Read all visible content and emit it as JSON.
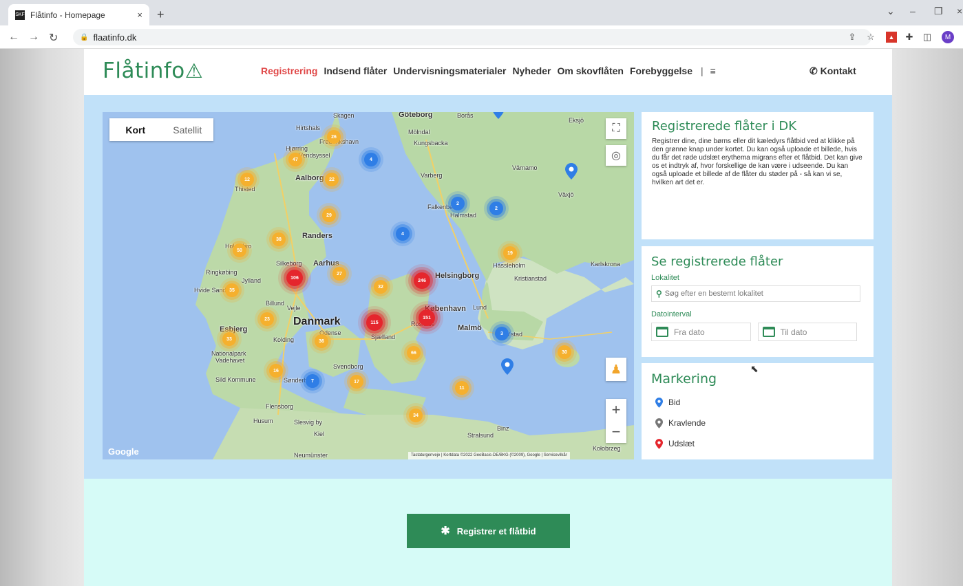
{
  "browser": {
    "tab_title": "Flåtinfo - Homepage",
    "favicon_text": "SKF",
    "url": "flaatinfo.dk",
    "avatar_letter": "M"
  },
  "header": {
    "logo": "Flåtinfo",
    "nav": [
      "Registrering",
      "Indsend flåter",
      "Undervisningsmaterialer",
      "Nyheder",
      "Om skovflåten",
      "Forebyggelse"
    ],
    "contact": "Kontakt"
  },
  "map": {
    "toggle_map": "Kort",
    "toggle_satellite": "Satellit",
    "google": "Google",
    "attribution": "Tastaturgenveje | Kortdata ©2022 GeoBasis-DE/BKG (©2009), Google | Servicevilkår",
    "labels": {
      "skagen": "Skagen",
      "goteborg": "Göteborg",
      "boras": "Borås",
      "eksjo": "Eksjö",
      "hirtshals": "Hirtshals",
      "frederikshavn": "Frederikshavn",
      "molndal": "Mölndal",
      "kungsbacka": "Kungsbacka",
      "hjorring": "Hjørring",
      "vendsyssel": "Vendsyssel",
      "varnamo": "Värnamo",
      "aalborg": "Aalborg",
      "varberg": "Varberg",
      "thisted": "Thisted",
      "vaxjo": "Växjö",
      "falkenberg": "Falkenberg",
      "halmstad": "Halmstad",
      "randers": "Randers",
      "holstebro": "Holstebro",
      "hassleholm": "Hässleholm",
      "karlskrona": "Karlskrona",
      "silkeborg": "Silkeborg",
      "aarhus": "Aarhus",
      "ringkobing": "Ringkøbing",
      "jylland": "Jylland",
      "helsingborg": "Helsingborg",
      "kristianstad": "Kristianstad",
      "hvide_sande": "Hvide Sande",
      "billund": "Billund",
      "vejle": "Vejle",
      "kobenhavn": "København",
      "lund": "Lund",
      "danmark": "Danmark",
      "roskilde": "Roskilde",
      "malmo": "Malmö",
      "esbjerg": "Esbjerg",
      "kolding": "Kolding",
      "odense": "Odense",
      "sjaelland": "Sjælland",
      "ystad": "Ystad",
      "nationalpark": "Nationalpark",
      "vadehavet": "Vadehavet",
      "svendborg": "Svendborg",
      "sild": "Sild Kommune",
      "sonderborg": "Sønderborg",
      "flensborg": "Flensborg",
      "husum": "Husum",
      "slesvig": "Slesvig by",
      "binz": "Binz",
      "kiel": "Kiel",
      "stralsund": "Stralsund",
      "kolobrzeg": "Kołobrzeg",
      "neumunster": "Neumünster"
    },
    "clusters": {
      "c26": "26",
      "c47": "47",
      "c4a": "4",
      "c12": "12",
      "c22": "22",
      "c2a": "2",
      "c2b": "2",
      "c29": "29",
      "c4b": "4",
      "c38": "38",
      "c50": "50",
      "c19": "19",
      "c106": "106",
      "c27": "27",
      "c246": "246",
      "c35": "35",
      "c32": "32",
      "c115": "115",
      "c151": "151",
      "c23": "23",
      "c3": "3",
      "c33": "33",
      "c36": "36",
      "c66": "66",
      "c30": "30",
      "c16": "16",
      "c7": "7",
      "c17": "17",
      "c11": "11",
      "c34": "34"
    }
  },
  "panel1": {
    "title": "Registrerede flåter i DK",
    "text": "Registrer dine, dine børns eller dit kæledyrs flåtbid ved at klikke på den grønne knap under kortet. Du kan også uploade et billede, hvis du får det røde udslæt erythema migrans efter et flåtbid. Det kan give os et indtryk af, hvor forskellige de kan være i udseende. Du kan også uploade et billede af de flåter du støder på - så kan vi se, hvilken art det er."
  },
  "panel2": {
    "title": "Se registrerede flåter",
    "location_label": "Lokalitet",
    "search_placeholder": "Søg efter en bestemt lokalitet",
    "date_label": "Datointerval",
    "from_date": "Fra dato",
    "to_date": "Til dato"
  },
  "panel3": {
    "title": "Markering",
    "items": [
      {
        "label": "Bid",
        "color": "#2f7ee6"
      },
      {
        "label": "Kravlende",
        "color": "#777777"
      },
      {
        "label": "Udslæt",
        "color": "#e5262d"
      }
    ]
  },
  "cta": {
    "label": "Registrer et flåtbid"
  },
  "colors": {
    "brand": "#2e8b57",
    "accent": "#e04848",
    "band": "#c1e1f9",
    "bottom": "#d6fbf7"
  }
}
